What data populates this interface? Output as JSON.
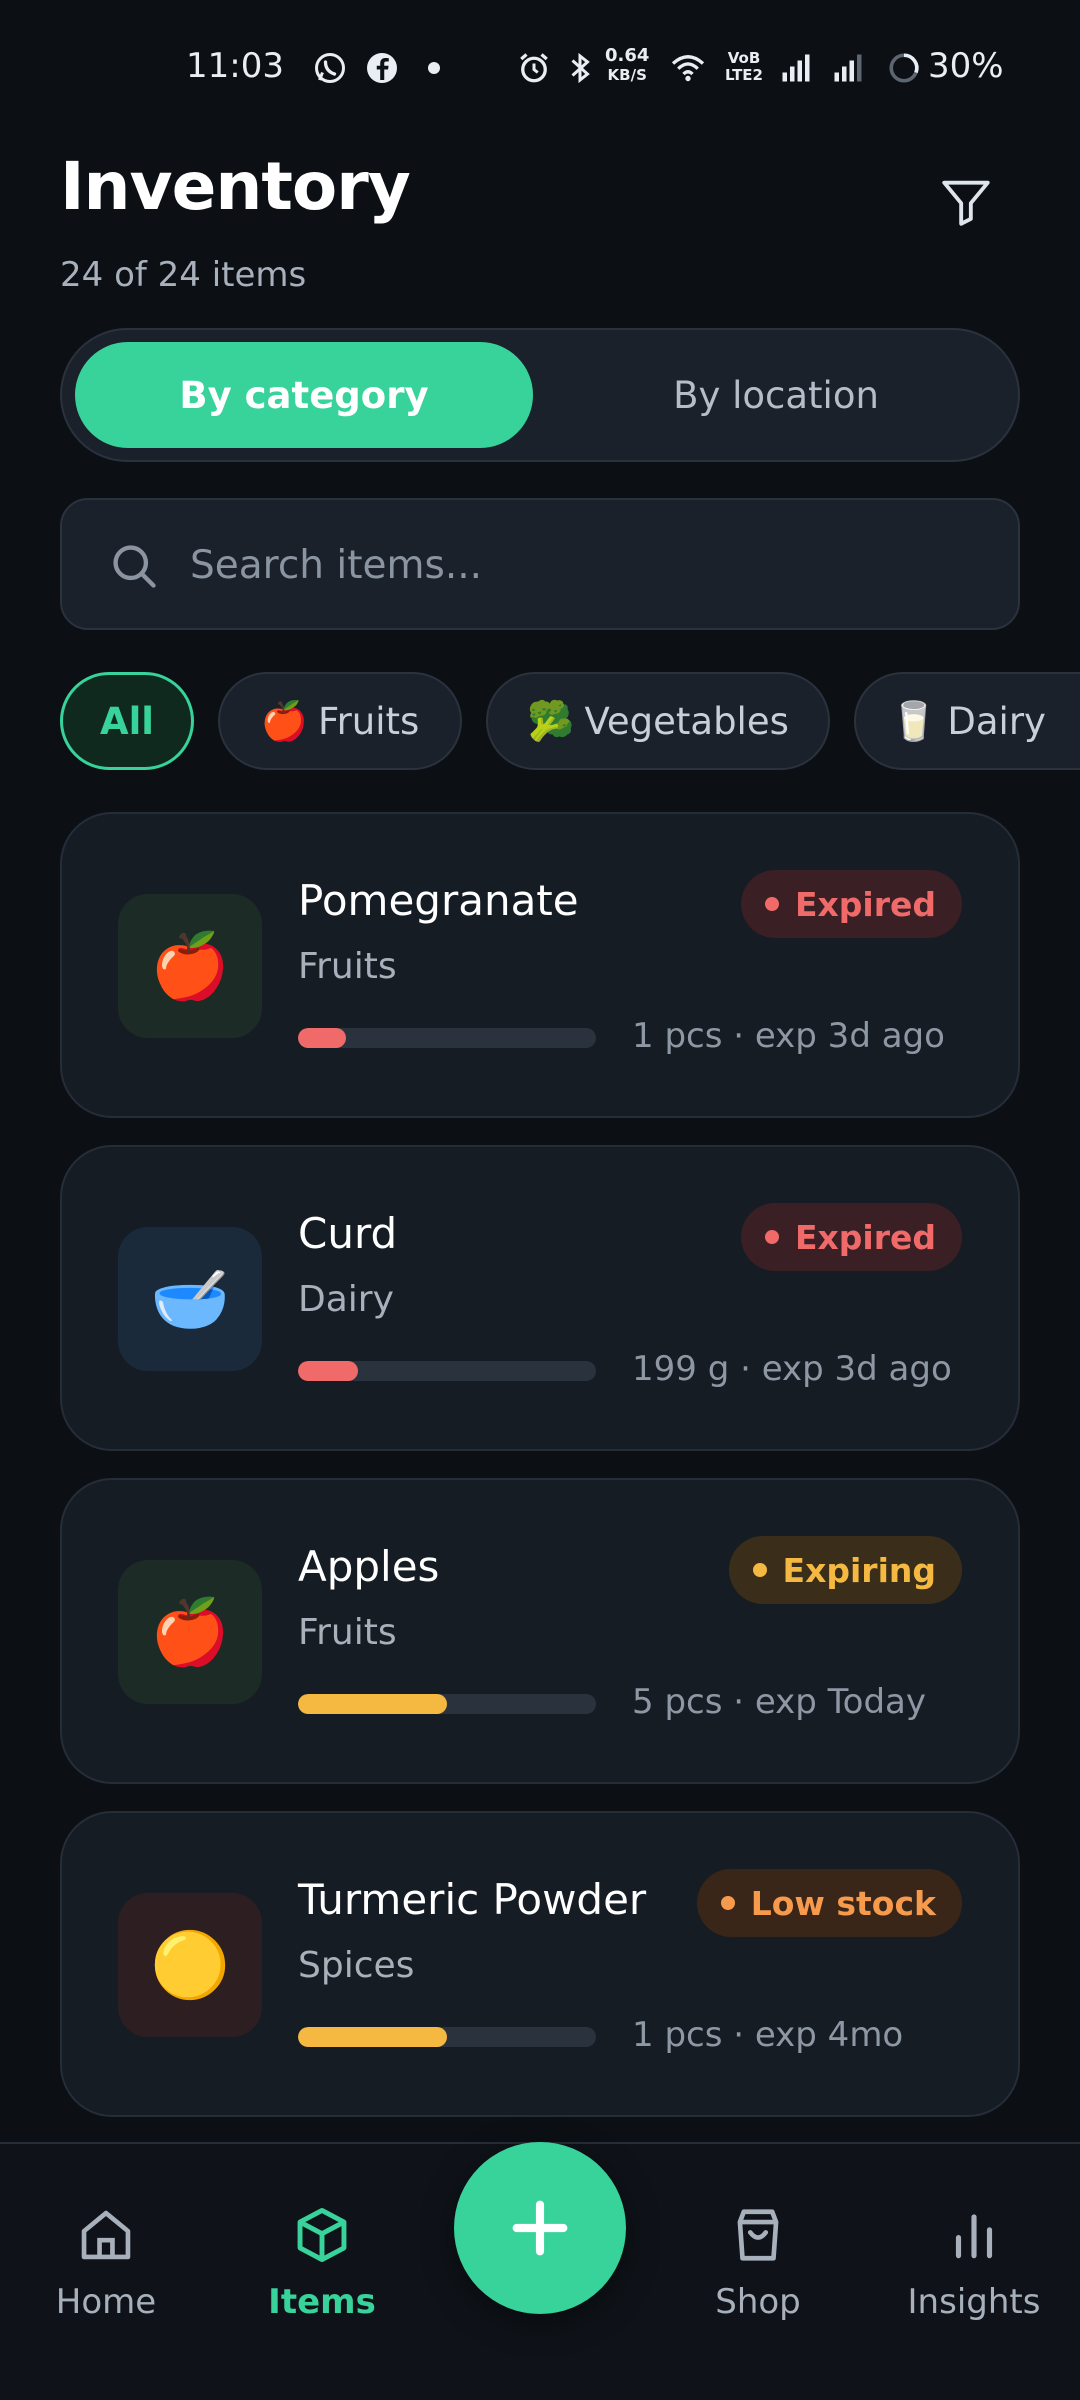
{
  "status_bar": {
    "time": "11:03",
    "net_speed_value": "0.64",
    "net_speed_unit": "KB/S",
    "volte_top": "VoB",
    "volte_bottom": "LTE2",
    "battery": "30%",
    "icons": [
      "whatsapp-icon",
      "facebook-icon",
      "dot-icon",
      "alarm-icon",
      "bluetooth-icon",
      "wifi-icon",
      "signal-icon",
      "signal-icon",
      "battery-ring-icon"
    ]
  },
  "header": {
    "title": "Inventory",
    "subtitle": "24 of 24 items",
    "filter_icon": "filter-icon"
  },
  "view_toggle": {
    "options": [
      {
        "label": "By category",
        "selected": true
      },
      {
        "label": "By location",
        "selected": false
      }
    ]
  },
  "search": {
    "placeholder": "Search items...",
    "value": "",
    "icon": "search-icon"
  },
  "filter_chips": [
    {
      "label": "All",
      "emoji": "",
      "active": true
    },
    {
      "label": "Fruits",
      "emoji": "🍎",
      "active": false
    },
    {
      "label": "Vegetables",
      "emoji": "🥦",
      "active": false
    },
    {
      "label": "Dairy",
      "emoji": "🥛",
      "active": false
    }
  ],
  "items": [
    {
      "name": "Pomegranate",
      "category": "Fruits",
      "emoji": "🍎",
      "thumb_bg": "#1c2b25",
      "meta": "1 pcs · exp 3d ago",
      "badge": "Expired",
      "badge_color": "#f06a6a",
      "badge_bg": "#3a1f24",
      "level": 0.16,
      "bar_color": "#f06a6a"
    },
    {
      "name": "Curd",
      "category": "Dairy",
      "emoji": "🥣",
      "thumb_bg": "#1a2a3b",
      "meta": "199 g · exp 3d ago",
      "badge": "Expired",
      "badge_color": "#f06a6a",
      "badge_bg": "#3a1f24",
      "level": 0.2,
      "bar_color": "#f06a6a"
    },
    {
      "name": "Apples",
      "category": "Fruits",
      "emoji": "🍎",
      "thumb_bg": "#1c2b25",
      "meta": "5 pcs · exp Today",
      "badge": "Expiring",
      "badge_color": "#f5b942",
      "badge_bg": "#3a2e1b",
      "level": 0.5,
      "bar_color": "#f5b942"
    },
    {
      "name": "Turmeric Powder",
      "category": "Spices",
      "emoji": "🟡",
      "thumb_bg": "#2d1e22",
      "meta": "1 pcs · exp 4mo",
      "badge": "Low stock",
      "badge_color": "#f79a4c",
      "badge_bg": "#3a2619",
      "level": 0.5,
      "bar_color": "#f5b942"
    }
  ],
  "bottom_nav": {
    "items": [
      {
        "label": "Home",
        "icon": "home-icon",
        "active": false
      },
      {
        "label": "Items",
        "icon": "cube-icon",
        "active": true
      },
      {
        "label": "Shop",
        "icon": "shopping-bag-icon",
        "active": false
      },
      {
        "label": "Insights",
        "icon": "bar-chart-icon",
        "active": false
      }
    ],
    "fab_icon": "plus-icon"
  },
  "colors": {
    "accent": "#37d39a",
    "background": "#0c1015",
    "card": "#161c24",
    "expired": "#f06a6a",
    "expiring": "#f5b942",
    "low_stock": "#f79a4c"
  }
}
